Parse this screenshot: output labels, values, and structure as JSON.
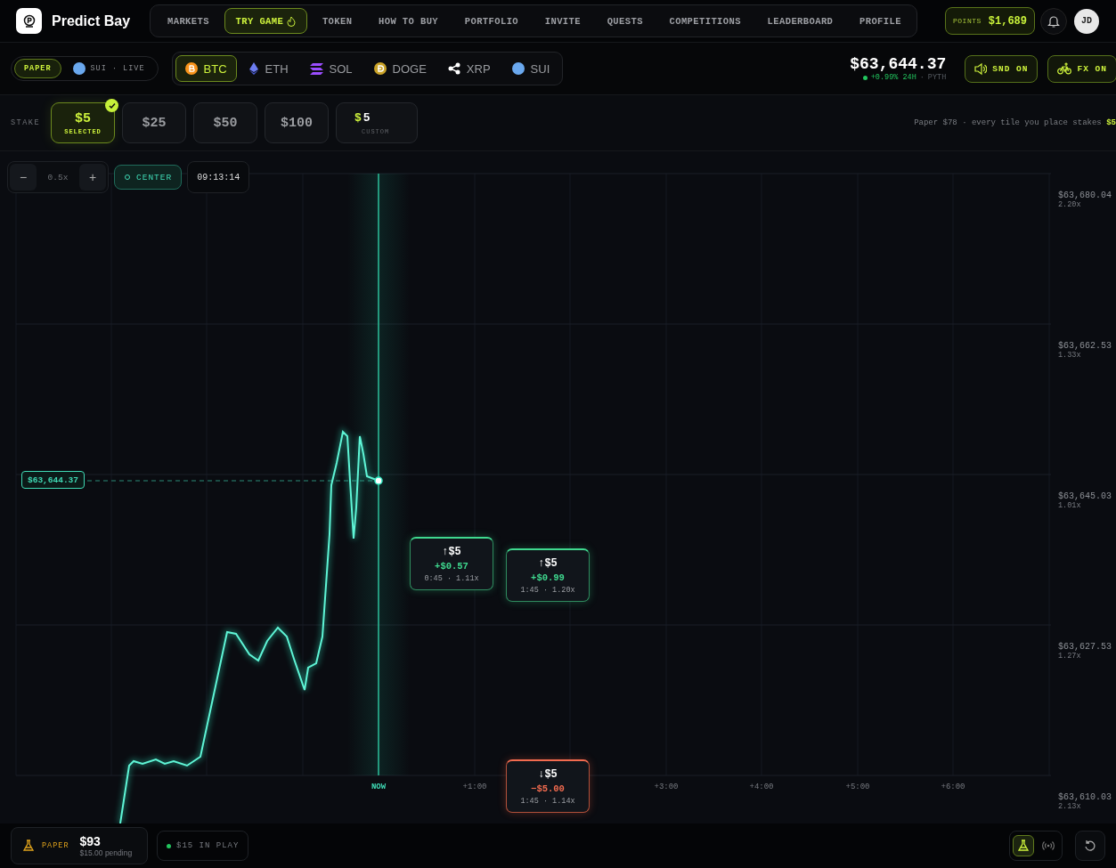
{
  "brand": {
    "name": "Predict Bay"
  },
  "nav": [
    {
      "label": "MARKETS",
      "selected": false,
      "hot": false
    },
    {
      "label": "TRY GAME",
      "selected": true,
      "hot": true
    },
    {
      "label": "TOKEN",
      "selected": false,
      "hot": false
    },
    {
      "label": "HOW TO BUY",
      "selected": false,
      "hot": false
    },
    {
      "label": "PORTFOLIO",
      "selected": false,
      "hot": false
    },
    {
      "label": "INVITE",
      "selected": false,
      "hot": false
    },
    {
      "label": "QUESTS",
      "selected": false,
      "hot": false
    },
    {
      "label": "COMPETITIONS",
      "selected": false,
      "hot": false
    },
    {
      "label": "LEADERBOARD",
      "selected": false,
      "hot": false
    },
    {
      "label": "PROFILE",
      "selected": false,
      "hot": false
    }
  ],
  "points": {
    "label": "POINTS",
    "value": "$1,689"
  },
  "avatar": {
    "initials": "JD"
  },
  "modes": [
    {
      "label": "PAPER",
      "selected": true,
      "kind": "plain"
    },
    {
      "label": "SUI · LIVE",
      "selected": false,
      "kind": "sui"
    }
  ],
  "assets": [
    {
      "symbol": "BTC",
      "selected": true,
      "kind": "btc"
    },
    {
      "symbol": "ETH",
      "selected": false,
      "kind": "eth"
    },
    {
      "symbol": "SOL",
      "selected": false,
      "kind": "sol"
    },
    {
      "symbol": "DOGE",
      "selected": false,
      "kind": "doge"
    },
    {
      "symbol": "XRP",
      "selected": false,
      "kind": "xrp"
    },
    {
      "symbol": "SUI",
      "selected": false,
      "kind": "sui"
    }
  ],
  "ticker": {
    "price": "$63,644.37",
    "change": "+0.99% 24H",
    "separator": "·",
    "source": "PYTH"
  },
  "toggles": [
    {
      "label": "SND ON",
      "kind": "sound",
      "on": true
    },
    {
      "label": "FX ON",
      "kind": "fx",
      "on": true
    }
  ],
  "stake": {
    "label": "STAKE",
    "options": [
      {
        "amount": "$5",
        "note": "SELECTED",
        "selected": true
      },
      {
        "amount": "$25",
        "selected": false
      },
      {
        "amount": "$50",
        "selected": false
      },
      {
        "amount": "$100",
        "selected": false
      }
    ],
    "custom": {
      "currency": "$",
      "value": "5",
      "label": "CUSTOM"
    },
    "hint": "Paper $78 · every tile you place stakes **$5**"
  },
  "zoom": {
    "minus": "−",
    "level": "0.5x",
    "plus": "+"
  },
  "center": {
    "label": "CENTER"
  },
  "clock": "09:13:14",
  "price_levels": [
    {
      "price": "$63,680.04",
      "multiplier": "2.20x"
    },
    {
      "price": "$63,662.53",
      "multiplier": "1.33x"
    },
    {
      "price": "$63,645.03",
      "multiplier": "1.01x"
    },
    {
      "price": "$63,627.53",
      "multiplier": "1.27x"
    },
    {
      "price": "$63,610.03",
      "multiplier": "2.13x"
    }
  ],
  "time_ticks": [
    "NOW",
    "+1:00",
    "+3:00",
    "+4:00",
    "+5:00",
    "+6:00"
  ],
  "current_price": "$63,644.37",
  "tiles": [
    {
      "kind": "up",
      "stake": "↑$5",
      "pnl": "+$0.57",
      "meta": "0:45 · 1.11x"
    },
    {
      "kind": "up",
      "stake": "↑$5",
      "pnl": "+$0.99",
      "meta": "1:45 · 1.20x"
    },
    {
      "kind": "down",
      "stake": "↓$5",
      "pnl": "−$5.00",
      "meta": "1:45 · 1.14x"
    }
  ],
  "footer": {
    "mode": "PAPER",
    "balance": "$93",
    "pending": "$15.00 pending",
    "in_play": "$15 IN PLAY",
    "views": [
      {
        "kind": "flask",
        "selected": true
      },
      {
        "kind": "broadcast",
        "selected": false
      }
    ]
  }
}
